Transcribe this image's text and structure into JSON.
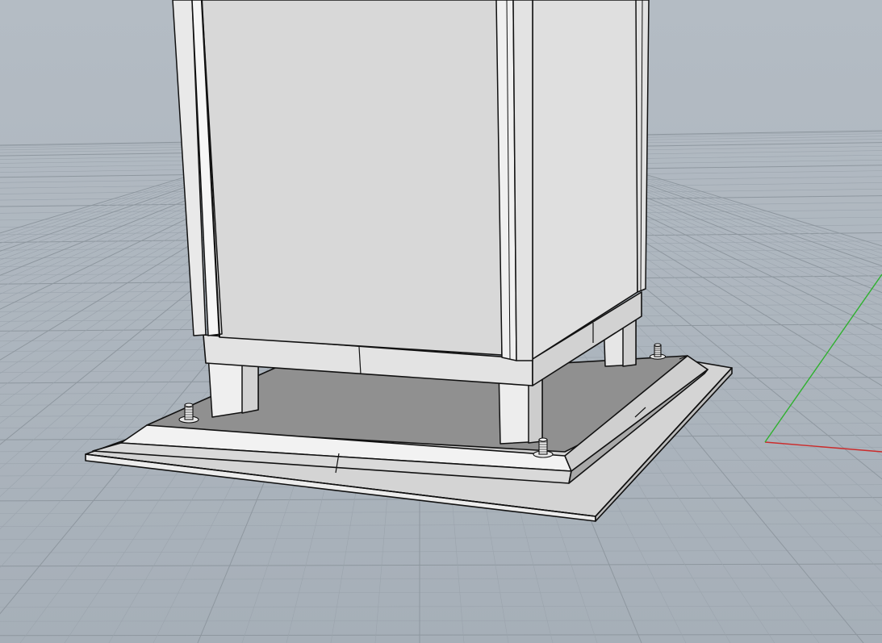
{
  "viewport": {
    "view": "perspective",
    "background_color": "#a9b2bb",
    "grid": true,
    "grid_minor_color": "#9ba4ad",
    "grid_major_color": "#8e979f",
    "axis_x_color": "#cc2b2b",
    "axis_y_color": "#2fb12f"
  },
  "model": {
    "objects": [
      "cabinet-body",
      "cabinet-corner-post-left",
      "cabinet-corner-post-front",
      "cabinet-corner-post-right",
      "cabinet-plinth",
      "support-leg-front-left",
      "support-leg-front",
      "support-leg-back-right",
      "base-plate",
      "anchor-bolt-left",
      "anchor-bolt-front",
      "anchor-bolt-right"
    ],
    "surface_color": "#d6d6d6",
    "shadow_face_color": "#8c8c8c",
    "edge_color": "#111111"
  }
}
